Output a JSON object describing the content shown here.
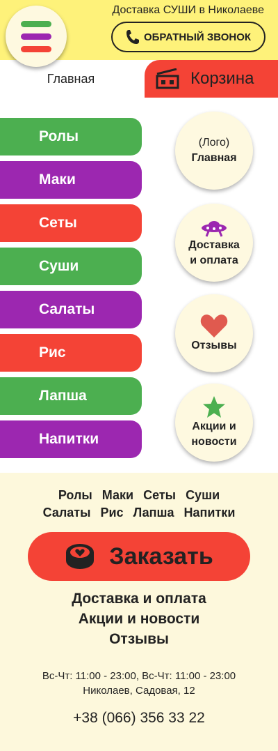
{
  "header": {
    "tagline": "Доставка СУШИ в Николаеве",
    "callback_label": "ОБРАТНЫЙ ЗВОНОК",
    "colors": {
      "background": "#fef27a",
      "green": "#4caf50",
      "purple": "#9c27b0",
      "red": "#f44336"
    }
  },
  "tabs": {
    "home_label": "Главная",
    "cart_label": "Корзина"
  },
  "menu": {
    "items": [
      {
        "label": "Ролы",
        "color": "green"
      },
      {
        "label": "Маки",
        "color": "purple"
      },
      {
        "label": "Сеты",
        "color": "red"
      },
      {
        "label": "Суши",
        "color": "green"
      },
      {
        "label": "Салаты",
        "color": "purple"
      },
      {
        "label": "Рис",
        "color": "red"
      },
      {
        "label": "Лапша",
        "color": "green"
      },
      {
        "label": "Напитки",
        "color": "purple"
      }
    ]
  },
  "circles": {
    "home_logo": "(Лого)",
    "home_label": "Главная",
    "delivery_line1": "Доставка",
    "delivery_line2": "и оплата",
    "reviews": "Отзывы",
    "promo_line1": "Акции и",
    "promo_line2": "новости",
    "icons": [
      "ufo-icon",
      "heart-icon",
      "star-icon"
    ]
  },
  "footer": {
    "cats_row1": [
      "Ролы",
      "Маки",
      "Сеты",
      "Суши"
    ],
    "cats_row2": [
      "Салаты",
      "Рис",
      "Лапша",
      "Напитки"
    ],
    "order_label": "Заказать",
    "link_delivery": "Доставка и оплата",
    "link_promo": "Акции и новости",
    "link_reviews": "Отзывы",
    "hours": "Вс-Чт:  11:00 - 23:00, Вс-Чт:  11:00 - 23:00",
    "address": "Николаев, Садовая, 12",
    "phone": "+38 (066) 356 33 22"
  }
}
